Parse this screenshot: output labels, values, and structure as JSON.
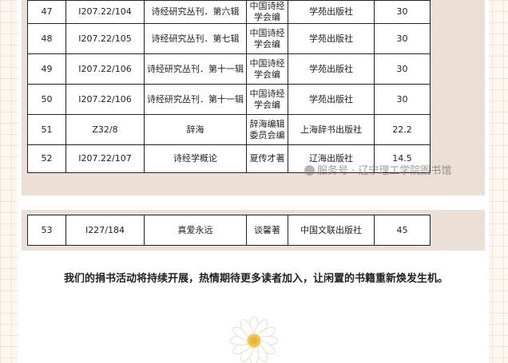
{
  "table_rows": [
    {
      "no": "47",
      "code": "I207.22/104",
      "title": "诗经研究丛刊．第六辑",
      "author": "中国诗经学会编",
      "publisher": "学苑出版社",
      "price": "30"
    },
    {
      "no": "48",
      "code": "I207.22/105",
      "title": "诗经研究丛刊．第七辑",
      "author": "中国诗经学会编",
      "publisher": "学苑出版社",
      "price": "30"
    },
    {
      "no": "49",
      "code": "I207.22/106",
      "title": "诗经研究丛刊．第十一辑",
      "author": "中国诗经学会编",
      "publisher": "学苑出版社",
      "price": "30"
    },
    {
      "no": "50",
      "code": "I207.22/106",
      "title": "诗经研究丛刊．第十一辑",
      "author": "中国诗经学会编",
      "publisher": "学苑出版社",
      "price": "30"
    },
    {
      "no": "51",
      "code": "Z32/8",
      "title": "辞海",
      "author": "辞海编辑委员会编",
      "publisher": "上海辞书出版社",
      "price": "22.2"
    },
    {
      "no": "52",
      "code": "I207.22/107",
      "title": "诗经学概论",
      "author": "夏传才著",
      "publisher": "辽海出版社",
      "price": "14.5"
    }
  ],
  "table2_rows": [
    {
      "no": "53",
      "code": "I227/184",
      "title": "真爱永远",
      "author": "谈馨著",
      "publisher": "中国文联出版社",
      "price": "45"
    }
  ],
  "watermark": "服务号 · 辽宁理工学院图书馆",
  "closing_text": "我们的捐书活动将持续开展，热情期待更多读者加入，让闲置的书籍重新焕发生机。",
  "colors": {
    "panel": "#ece0d6",
    "grid": "#e2cdbc",
    "page": "#fdf7f2"
  },
  "decoration_icon": "daisy-flower-icon"
}
